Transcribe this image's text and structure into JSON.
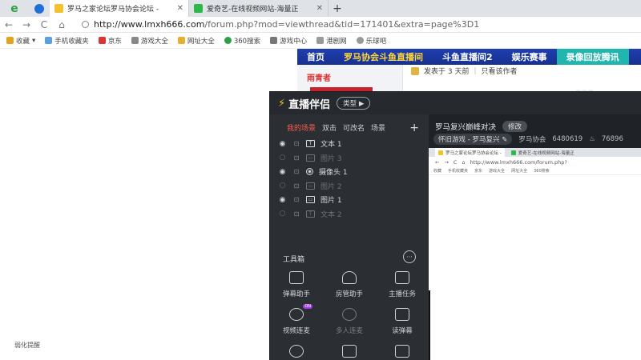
{
  "browser": {
    "tabs": [
      {
        "title": "罗马之家论坛罗马协会论坛 - ",
        "favicon_color": "#f2c12e",
        "active": true
      },
      {
        "title": "爱奇艺-在线视频网站-海量正",
        "favicon_color": "#2eb84a",
        "active": false
      }
    ],
    "new_tab": "+",
    "nav": {
      "back": "←",
      "forward": "→",
      "reload": "C",
      "home": "⌂"
    },
    "url_host": "http://www.lmxh666.com",
    "url_rest": "/forum.php?mod=viewthread&tid=171401&extra=page%3D1",
    "bookmarks": [
      {
        "label": "收藏",
        "icon": "star-icon",
        "color": "#e3a31c"
      },
      {
        "label": "手机收藏夹",
        "icon": "phone-icon",
        "color": "#5aa0e0"
      },
      {
        "label": "京东",
        "icon": "jd-icon",
        "color": "#d33"
      },
      {
        "label": "游戏大全",
        "icon": "game-icon",
        "color": "#888"
      },
      {
        "label": "网址大全",
        "icon": "web-icon",
        "color": "#e3b12e"
      },
      {
        "label": "360搜索",
        "icon": "search360-icon",
        "color": "#2ea043"
      },
      {
        "label": "游戏中心",
        "icon": "gamecenter-icon",
        "color": "#777"
      },
      {
        "label": "港剧网",
        "icon": "tv-icon",
        "color": "#999"
      },
      {
        "label": "乐球吧",
        "icon": "ball-icon",
        "color": "#999"
      }
    ]
  },
  "forum": {
    "nav_items": [
      {
        "label": "首页",
        "style": "plain"
      },
      {
        "label": "罗马协会斗鱼直播间",
        "style": "yellow"
      },
      {
        "label": "斗鱼直播间2",
        "style": "plain"
      },
      {
        "label": "娱乐赛事",
        "style": "plain"
      },
      {
        "label": "录像回放腾讯",
        "style": "teal"
      }
    ],
    "author_name": "雨青者",
    "posted": "发表于 3 天前",
    "only_author": "只看该作者",
    "left_text": "弱化提醒"
  },
  "app": {
    "logo": "直播伴侣",
    "mode_pill": "类型 ▶",
    "scene_tabs": [
      {
        "label": "我的场景",
        "active": true
      },
      {
        "label": "双击",
        "active": false
      },
      {
        "label": "可改名",
        "active": false
      },
      {
        "label": "场景",
        "active": false
      }
    ],
    "add_scene": "+",
    "sources": [
      {
        "label": "文本 1",
        "kind": "T",
        "visible": true
      },
      {
        "label": "图片 3",
        "kind": "▭",
        "visible": false
      },
      {
        "label": "摄像头 1",
        "kind": "◉",
        "visible": true
      },
      {
        "label": "图片 2",
        "kind": "▭",
        "visible": false
      },
      {
        "label": "图片 1",
        "kind": "▭",
        "visible": true
      },
      {
        "label": "文本 2",
        "kind": "T",
        "visible": false
      }
    ],
    "toolbox_title": "工具箱",
    "toolbox_more": "···",
    "tools": [
      {
        "label": "弹幕助手",
        "dim": false,
        "badge": ""
      },
      {
        "label": "房管助手",
        "dim": false,
        "badge": ""
      },
      {
        "label": "主播任务",
        "dim": false,
        "badge": ""
      },
      {
        "label": "视频连麦",
        "dim": false,
        "badge": "ON"
      },
      {
        "label": "多人连麦",
        "dim": true,
        "badge": ""
      },
      {
        "label": "读弹幕",
        "dim": false,
        "badge": ""
      },
      {
        "label": "",
        "dim": false,
        "badge": ""
      },
      {
        "label": "",
        "dim": false,
        "badge": ""
      },
      {
        "label": "",
        "dim": false,
        "badge": ""
      }
    ],
    "stream_title": "罗马复兴巅峰对决",
    "edit_label": "修改",
    "category": "怀旧游戏 - 罗马复兴",
    "channel": "罗马协会",
    "room_id": "6480619",
    "viewers": "76896",
    "preview": {
      "tab1": "罗马之家论坛罗马协会论坛 -",
      "tab2": "爱奇艺-在线视频网站-海量正",
      "url": "http://www.lmxh666.com/forum.php?",
      "bookmarks": [
        "收藏",
        "手机收藏夹",
        "京东",
        "游戏大全",
        "网址大全",
        "360搜索"
      ]
    }
  }
}
